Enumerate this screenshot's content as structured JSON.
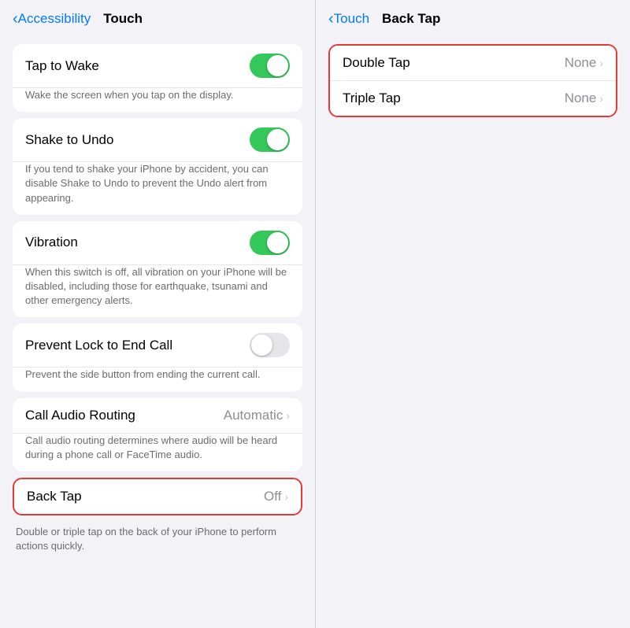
{
  "left": {
    "nav": {
      "back_label": "Accessibility",
      "title": "Touch"
    },
    "sections": [
      {
        "rows": [
          {
            "label": "Tap to Wake",
            "type": "toggle",
            "value": true
          }
        ],
        "description": "Wake the screen when you tap on the display."
      },
      {
        "rows": [
          {
            "label": "Shake to Undo",
            "type": "toggle",
            "value": true
          }
        ],
        "description": "If you tend to shake your iPhone by accident, you can disable Shake to Undo to prevent the Undo alert from appearing."
      },
      {
        "rows": [
          {
            "label": "Vibration",
            "type": "toggle",
            "value": true
          }
        ],
        "description": "When this switch is off, all vibration on your iPhone will be disabled, including those for earthquake, tsunami and other emergency alerts."
      },
      {
        "rows": [
          {
            "label": "Prevent Lock to End Call",
            "type": "toggle",
            "value": false
          }
        ],
        "description": "Prevent the side button from ending the current call."
      },
      {
        "rows": [
          {
            "label": "Call Audio Routing",
            "type": "nav",
            "value": "Automatic"
          }
        ],
        "description": "Call audio routing determines where audio will be heard during a phone call or FaceTime audio."
      },
      {
        "highlighted": true,
        "rows": [
          {
            "label": "Back Tap",
            "type": "nav",
            "value": "Off"
          }
        ],
        "description": "Double or triple tap on the back of your iPhone to perform actions quickly."
      }
    ]
  },
  "right": {
    "nav": {
      "back_label": "Touch",
      "title": "Back Tap"
    },
    "options": [
      {
        "label": "Double Tap",
        "value": "None"
      },
      {
        "label": "Triple Tap",
        "value": "None"
      }
    ]
  }
}
